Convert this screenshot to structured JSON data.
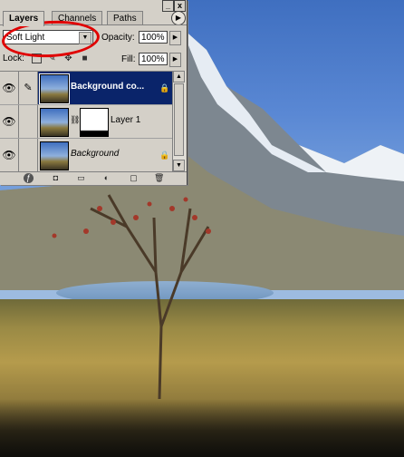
{
  "palette": {
    "tabs": [
      {
        "label": "Layers",
        "active": true
      },
      {
        "label": "Channels",
        "active": false
      },
      {
        "label": "Paths",
        "active": false
      }
    ],
    "window_buttons": {
      "minimize": "_",
      "close": "x"
    },
    "blend_mode": "Soft Light",
    "opacity_label": "Opacity:",
    "opacity_value": "100%",
    "lock_label": "Lock:",
    "fill_label": "Fill:",
    "fill_value": "100%",
    "layers": [
      {
        "name": "Background co...",
        "selected": true,
        "visible": true,
        "locked": true,
        "has_mask": false
      },
      {
        "name": "Layer 1",
        "selected": false,
        "visible": true,
        "locked": false,
        "has_mask": true
      },
      {
        "name": "Background",
        "selected": false,
        "visible": true,
        "locked": true,
        "has_mask": false
      }
    ],
    "bottom_icons": [
      "layer-style-icon",
      "add-mask-icon",
      "new-group-icon",
      "adjustment-layer-icon",
      "new-layer-icon",
      "trash-icon"
    ]
  },
  "colors": {
    "selection": "#0a246a",
    "highlight_circle": "#e00000",
    "panel": "#d4d0c8"
  }
}
